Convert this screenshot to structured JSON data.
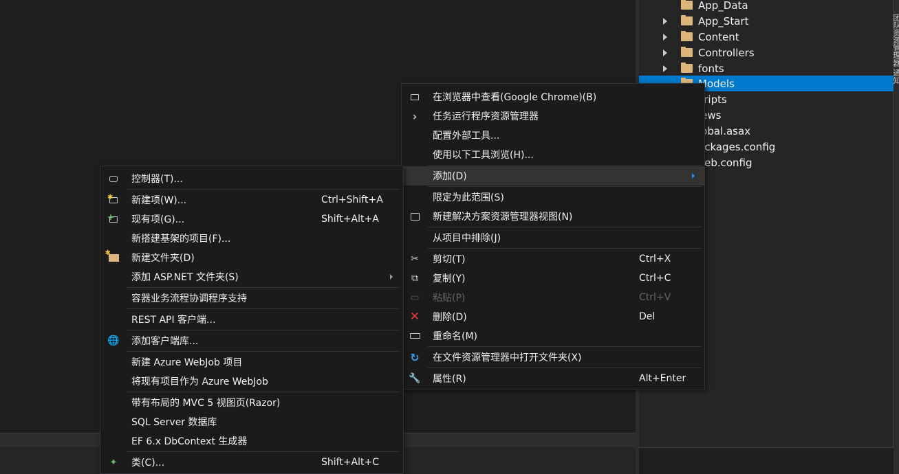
{
  "solution_explorer": {
    "items": [
      {
        "label": "App_Data",
        "arrow": false,
        "folder": true
      },
      {
        "label": "App_Start",
        "arrow": true,
        "folder": true
      },
      {
        "label": "Content",
        "arrow": true,
        "folder": true
      },
      {
        "label": "Controllers",
        "arrow": true,
        "folder": true
      },
      {
        "label": "fonts",
        "arrow": true,
        "folder": true
      },
      {
        "label": "Models",
        "arrow": false,
        "folder": true,
        "selected": true
      },
      {
        "label": "cripts",
        "arrow": false,
        "folder": false
      },
      {
        "label": "iews",
        "arrow": false,
        "folder": false
      },
      {
        "label": "lobal.asax",
        "arrow": false,
        "folder": false
      },
      {
        "label": "ackages.config",
        "arrow": false,
        "folder": false
      },
      {
        "label": "Veb.config",
        "arrow": false,
        "folder": false
      }
    ],
    "side_strip_text": "团队资源管理器   通知"
  },
  "context_menu": {
    "view_in_browser": "在浏览器中查看(Google Chrome)(B)",
    "task_runner": "任务运行程序资源管理器",
    "configure_tools": "配置外部工具...",
    "browse_with": "使用以下工具浏览(H)...",
    "add": "添加(D)",
    "scope_to_this": "限定为此范围(S)",
    "new_solution_view": "新建解决方案资源管理器视图(N)",
    "exclude_from_project": "从项目中排除(J)",
    "cut": "剪切(T)",
    "cut_shortcut": "Ctrl+X",
    "copy": "复制(Y)",
    "copy_shortcut": "Ctrl+C",
    "paste": "粘贴(P)",
    "paste_shortcut": "Ctrl+V",
    "delete": "删除(D)",
    "delete_shortcut": "Del",
    "rename": "重命名(M)",
    "open_in_explorer": "在文件资源管理器中打开文件夹(X)",
    "properties": "属性(R)",
    "properties_shortcut": "Alt+Enter"
  },
  "add_submenu": {
    "controller": "控制器(T)...",
    "new_item": "新建项(W)...",
    "new_item_shortcut": "Ctrl+Shift+A",
    "existing_item": "现有项(G)...",
    "existing_item_shortcut": "Shift+Alt+A",
    "new_scaffolded_item": "新搭建基架的项目(F)...",
    "new_folder": "新建文件夹(D)",
    "add_aspnet_folder": "添加 ASP.NET 文件夹(S)",
    "container_orchestrator": "容器业务流程协调程序支持",
    "rest_api_client": "REST API 客户端...",
    "client_library": "添加客户端库...",
    "new_azure_webjob": "新建 Azure WebJob 项目",
    "existing_as_webjob": "将现有项目作为 Azure WebJob",
    "mvc5_view_page": "带有布局的 MVC 5 视图页(Razor)",
    "sql_server_db": "SQL Server 数据库",
    "ef_dbcontext": "EF 6.x DbContext 生成器",
    "class": "类(C)...",
    "class_shortcut": "Shift+Alt+C"
  }
}
